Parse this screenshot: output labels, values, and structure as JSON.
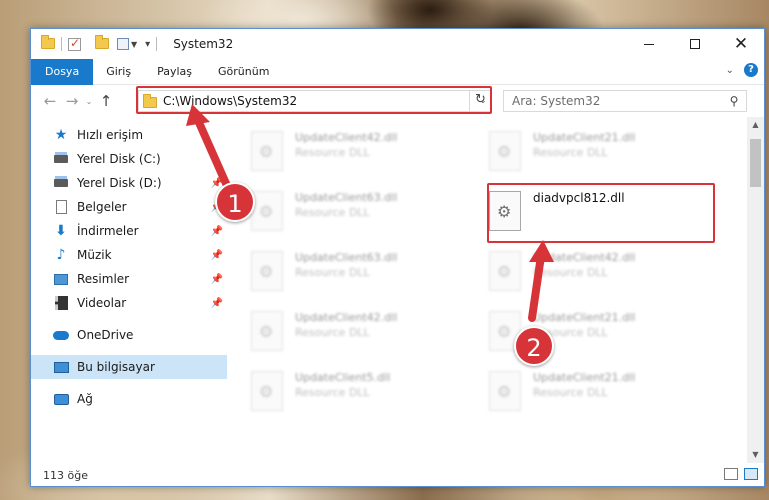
{
  "window": {
    "title": "System32",
    "min_symbol": "",
    "close_symbol": "✕"
  },
  "ribbon": {
    "tabs": [
      {
        "label": "Dosya",
        "active": true
      },
      {
        "label": "Giriş"
      },
      {
        "label": "Paylaş"
      },
      {
        "label": "Görünüm"
      }
    ],
    "help_symbol": "?"
  },
  "nav": {
    "address": "C:\\Windows\\System32",
    "search_placeholder": "Ara: System32"
  },
  "sidebar": {
    "items": [
      {
        "label": "Hızlı erişim",
        "icon": "star-icon"
      },
      {
        "label": "Yerel Disk (C:)",
        "icon": "drive-icon",
        "pinned": true
      },
      {
        "label": "Yerel Disk (D:)",
        "icon": "drive-icon",
        "pinned": true
      },
      {
        "label": "Belgeler",
        "icon": "documents-icon",
        "pinned": true
      },
      {
        "label": "İndirmeler",
        "icon": "download-icon",
        "pinned": true
      },
      {
        "label": "Müzik",
        "icon": "music-icon",
        "pinned": true
      },
      {
        "label": "Resimler",
        "icon": "pictures-icon",
        "pinned": true
      },
      {
        "label": "Videolar",
        "icon": "videos-icon",
        "pinned": true
      },
      {
        "label": "OneDrive",
        "icon": "onedrive-icon"
      },
      {
        "label": "Bu bilgisayar",
        "icon": "this-pc-icon",
        "selected": true
      },
      {
        "label": "Ağ",
        "icon": "network-icon"
      }
    ]
  },
  "files": [
    {
      "name": "UpdateClient42.dll",
      "type": "Resource DLL"
    },
    {
      "name": "UpdateClient21.dll",
      "type": "Resource DLL"
    },
    {
      "name": "UpdateClient63.dll",
      "type": "Resource DLL"
    },
    {
      "name": "diadvpcl812.dll",
      "type": ""
    },
    {
      "name": "UpdateClient63.dll",
      "type": "Resource DLL"
    },
    {
      "name": "UpdateClient42.dll",
      "type": "Resource DLL"
    },
    {
      "name": "UpdateClient42.dll",
      "type": "Resource DLL"
    },
    {
      "name": "UpdateClient21.dll",
      "type": "Resource DLL"
    },
    {
      "name": "UpdateClient5.dll",
      "type": "Resource DLL"
    },
    {
      "name": "UpdateClient21.dll",
      "type": "Resource DLL"
    }
  ],
  "status": {
    "item_count": "113 öğe"
  },
  "callouts": [
    "1",
    "2"
  ],
  "colors": {
    "accent": "#1979ca",
    "highlight": "#d7343a"
  }
}
